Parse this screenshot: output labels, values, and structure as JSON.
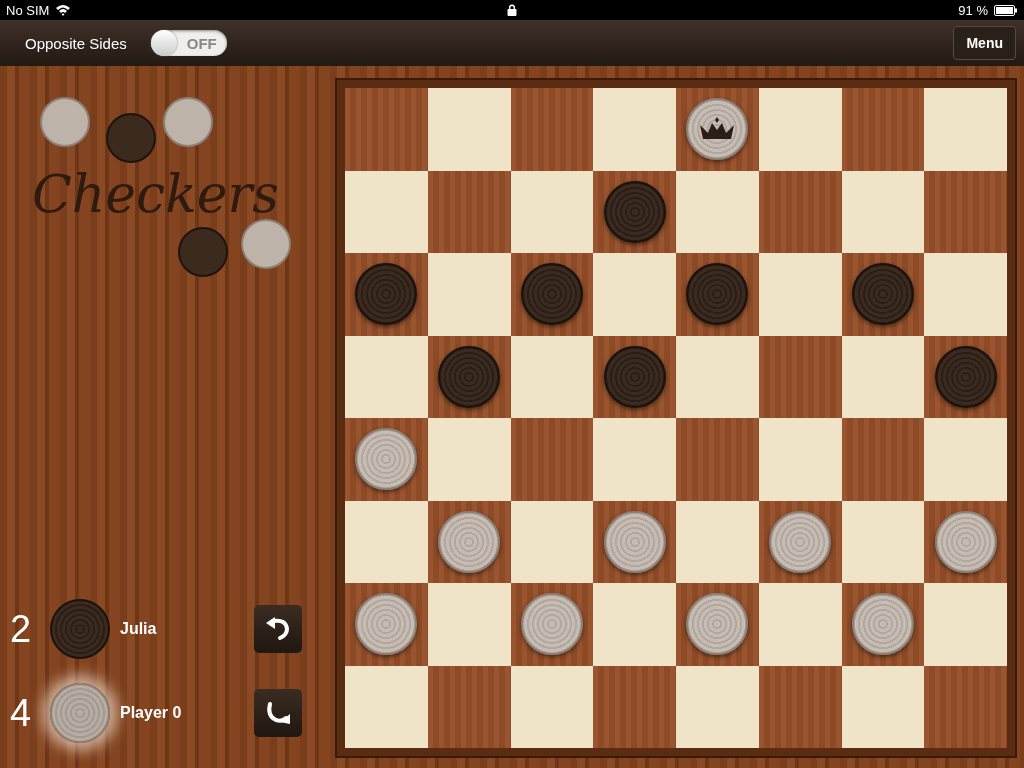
{
  "status_bar": {
    "carrier": "No SIM",
    "battery": "91 %"
  },
  "toolbar": {
    "toggle": {
      "label": "Opposite Sides",
      "on": false,
      "state_text": "OFF"
    },
    "menu_button": "Menu"
  },
  "logo": {
    "title": "Checkers"
  },
  "players": [
    {
      "score": "2",
      "name": "Julia",
      "kind": "dark",
      "selected": false
    },
    {
      "score": "4",
      "name": "Player 0",
      "kind": "light",
      "selected": true
    }
  ],
  "board": [
    [
      {
        "occupied": false
      },
      {
        "occupied": false
      },
      {
        "occupied": false
      },
      {
        "occupied": false
      },
      {
        "occupied": true,
        "dark": false,
        "king": true
      },
      {
        "occupied": false
      },
      {
        "occupied": false
      },
      {
        "occupied": false
      }
    ],
    [
      {
        "occupied": false
      },
      {
        "occupied": false
      },
      {
        "occupied": false
      },
      {
        "occupied": true,
        "dark": true,
        "king": false
      },
      {
        "occupied": false
      },
      {
        "occupied": false
      },
      {
        "occupied": false
      },
      {
        "occupied": false
      }
    ],
    [
      {
        "occupied": true,
        "dark": true,
        "king": false
      },
      {
        "occupied": false
      },
      {
        "occupied": true,
        "dark": true,
        "king": false
      },
      {
        "occupied": false
      },
      {
        "occupied": true,
        "dark": true,
        "king": false
      },
      {
        "occupied": false
      },
      {
        "occupied": true,
        "dark": true,
        "king": false
      },
      {
        "occupied": false
      }
    ],
    [
      {
        "occupied": false
      },
      {
        "occupied": true,
        "dark": true,
        "king": false
      },
      {
        "occupied": false
      },
      {
        "occupied": true,
        "dark": true,
        "king": false
      },
      {
        "occupied": false
      },
      {
        "occupied": false
      },
      {
        "occupied": false
      },
      {
        "occupied": true,
        "dark": true,
        "king": false
      }
    ],
    [
      {
        "occupied": true,
        "dark": false,
        "king": false
      },
      {
        "occupied": false
      },
      {
        "occupied": false
      },
      {
        "occupied": false
      },
      {
        "occupied": false
      },
      {
        "occupied": false
      },
      {
        "occupied": false
      },
      {
        "occupied": false
      }
    ],
    [
      {
        "occupied": false
      },
      {
        "occupied": true,
        "dark": false,
        "king": false
      },
      {
        "occupied": false
      },
      {
        "occupied": true,
        "dark": false,
        "king": false
      },
      {
        "occupied": false
      },
      {
        "occupied": true,
        "dark": false,
        "king": false
      },
      {
        "occupied": false
      },
      {
        "occupied": true,
        "dark": false,
        "king": false
      }
    ],
    [
      {
        "occupied": true,
        "dark": false,
        "king": false
      },
      {
        "occupied": false
      },
      {
        "occupied": true,
        "dark": false,
        "king": false
      },
      {
        "occupied": false
      },
      {
        "occupied": true,
        "dark": false,
        "king": false
      },
      {
        "occupied": false
      },
      {
        "occupied": true,
        "dark": false,
        "king": false
      },
      {
        "occupied": false
      }
    ],
    [
      {
        "occupied": false
      },
      {
        "occupied": false
      },
      {
        "occupied": false
      },
      {
        "occupied": false
      },
      {
        "occupied": false
      },
      {
        "occupied": false
      },
      {
        "occupied": false
      },
      {
        "occupied": false
      }
    ]
  ]
}
